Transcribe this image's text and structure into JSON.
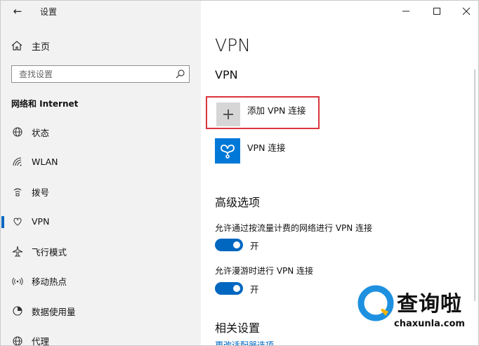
{
  "window": {
    "title": "设置"
  },
  "sidebar": {
    "home_label": "主页",
    "search_placeholder": "查找设置",
    "section_title": "网络和 Internet",
    "items": [
      {
        "label": "状态",
        "icon": "globe-icon"
      },
      {
        "label": "WLAN",
        "icon": "wifi-icon"
      },
      {
        "label": "拨号",
        "icon": "dialup-icon"
      },
      {
        "label": "VPN",
        "icon": "vpn-icon",
        "active": true
      },
      {
        "label": "飞行模式",
        "icon": "airplane-icon"
      },
      {
        "label": "移动热点",
        "icon": "hotspot-icon"
      },
      {
        "label": "数据使用量",
        "icon": "data-usage-icon"
      },
      {
        "label": "代理",
        "icon": "proxy-globe-icon"
      }
    ]
  },
  "main": {
    "page_title": "VPN",
    "section_title": "VPN",
    "add_vpn_label": "添加 VPN 连接",
    "vpn_connection_label": "VPN 连接",
    "advanced_title": "高级选项",
    "options": [
      {
        "label": "允许通过按流量计费的网络进行 VPN 连接",
        "state": "开",
        "on": true
      },
      {
        "label": "允许漫游时进行 VPN 连接",
        "state": "开",
        "on": true
      }
    ],
    "related_title": "相关设置",
    "related_link": "更改适配器选项"
  },
  "watermark": {
    "name": "查询啦",
    "url": "chaxunla.com"
  },
  "colors": {
    "accent": "#0067c0",
    "highlight_border": "#d9363e",
    "sidebar_bg": "#f2f2f2",
    "vpn_tile": "#0078d7"
  }
}
